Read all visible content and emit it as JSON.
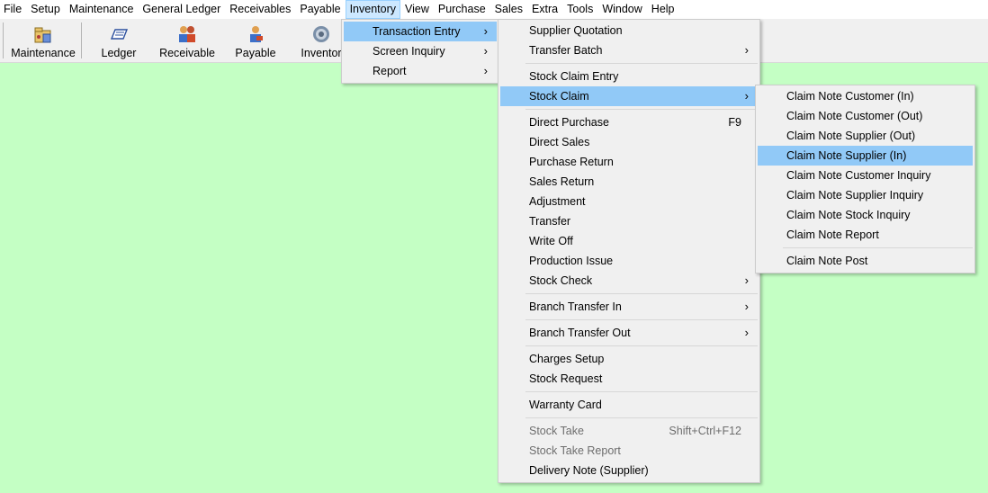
{
  "menubar": [
    {
      "label": "File",
      "open": false
    },
    {
      "label": "Setup",
      "open": false
    },
    {
      "label": "Maintenance",
      "open": false
    },
    {
      "label": "General Ledger",
      "open": false
    },
    {
      "label": "Receivables",
      "open": false
    },
    {
      "label": "Payable",
      "open": false
    },
    {
      "label": "Inventory",
      "open": true
    },
    {
      "label": "View",
      "open": false
    },
    {
      "label": "Purchase",
      "open": false
    },
    {
      "label": "Sales",
      "open": false
    },
    {
      "label": "Extra",
      "open": false
    },
    {
      "label": "Tools",
      "open": false
    },
    {
      "label": "Window",
      "open": false
    },
    {
      "label": "Help",
      "open": false
    }
  ],
  "toolbar": {
    "maintenance": "Maintenance",
    "ledger": "Ledger",
    "receivable": "Receivable",
    "payable": "Payable",
    "inventory": "Inventor"
  },
  "inventory_menu": [
    {
      "label": "Transaction Entry",
      "submenu": true,
      "highlighted": true
    },
    {
      "label": "Screen Inquiry",
      "submenu": true
    },
    {
      "label": "Report",
      "submenu": true
    }
  ],
  "transaction_menu": [
    {
      "label": "Supplier Quotation"
    },
    {
      "label": "Transfer Batch",
      "submenu": true
    },
    {
      "separator": true
    },
    {
      "label": "Stock Claim Entry"
    },
    {
      "label": "Stock Claim",
      "submenu": true,
      "highlighted": true
    },
    {
      "separator": true
    },
    {
      "label": "Direct Purchase",
      "shortcut": "F9"
    },
    {
      "label": "Direct Sales"
    },
    {
      "label": "Purchase Return"
    },
    {
      "label": "Sales Return"
    },
    {
      "label": "Adjustment"
    },
    {
      "label": "Transfer"
    },
    {
      "label": "Write Off"
    },
    {
      "label": "Production Issue"
    },
    {
      "label": "Stock Check",
      "submenu": true
    },
    {
      "separator": true
    },
    {
      "label": "Branch Transfer In",
      "submenu": true
    },
    {
      "separator": true
    },
    {
      "label": "Branch Transfer Out",
      "submenu": true
    },
    {
      "separator": true
    },
    {
      "label": "Charges Setup"
    },
    {
      "label": "Stock Request"
    },
    {
      "separator": true
    },
    {
      "label": "Warranty Card"
    },
    {
      "separator": true
    },
    {
      "label": "Stock Take",
      "shortcut": "Shift+Ctrl+F12",
      "disabled": true
    },
    {
      "label": "Stock Take Report",
      "disabled": true
    },
    {
      "label": "Delivery Note (Supplier)"
    }
  ],
  "stock_claim_menu": [
    {
      "label": "Claim Note Customer (In)"
    },
    {
      "label": "Claim Note Customer (Out)"
    },
    {
      "label": "Claim Note Supplier (Out)"
    },
    {
      "label": "Claim Note Supplier (In)",
      "highlighted": true
    },
    {
      "label": "Claim Note Customer Inquiry"
    },
    {
      "label": "Claim Note Supplier Inquiry"
    },
    {
      "label": "Claim Note Stock Inquiry"
    },
    {
      "label": "Claim Note Report"
    },
    {
      "separator": true
    },
    {
      "label": "Claim Note Post"
    }
  ],
  "colors": {
    "workspace_bg": "#c4ffc4",
    "menu_highlight": "#91c9f7",
    "menubar_open": "#cce8ff"
  }
}
